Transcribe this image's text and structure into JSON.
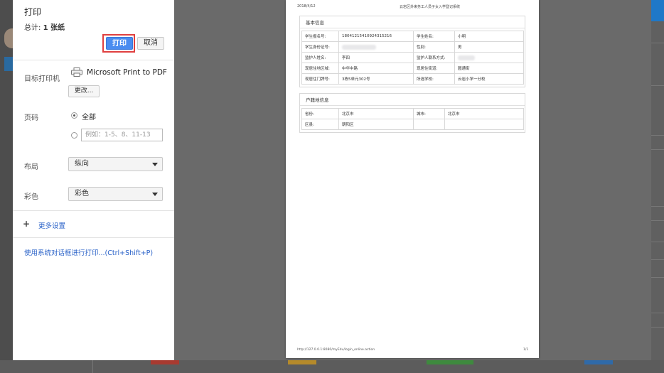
{
  "dialog": {
    "title": "打印",
    "total_label": "总计:",
    "total_value": "1 张纸",
    "print_label": "打印",
    "cancel_label": "取消",
    "destination_label": "目标打印机",
    "destination_name": "Microsoft Print to PDF",
    "change_label": "更改...",
    "pages_label": "页码",
    "pages_all": "全部",
    "pages_placeholder": "例如：1-5、8、11-13",
    "layout_label": "布局",
    "layout_value": "纵向",
    "color_label": "彩色",
    "color_value": "彩色",
    "more_settings": "更多设置",
    "system_dialog": "使用系统对话框进行打印...(Ctrl+Shift+P)"
  },
  "preview": {
    "date": "2018/4/12",
    "header_title": "云岩区外来务工人员子女入学登记系统",
    "basic_title": "基本信息",
    "basic_rows": [
      [
        "学生报名号:",
        "18041215410924315216",
        "学生姓名:",
        "小明"
      ],
      [
        "学生身份证号:",
        "",
        "性别:",
        "男"
      ],
      [
        "监护人姓名:",
        "李四",
        "监护人联系方式:",
        ""
      ],
      [
        "现居住地区域:",
        "中华中路",
        "现居住街道:",
        "圆通街"
      ],
      [
        "现居住门牌号:",
        "3栋5单元302号",
        "所选学校:",
        "云岩小学一分校"
      ]
    ],
    "household_title": "户籍地信息",
    "household_rows": [
      [
        "省份:",
        "北京市",
        "城市:",
        "北京市"
      ],
      [
        "区县:",
        "朝阳区",
        "",
        ""
      ]
    ],
    "footer_url": "http://127.0.0.1:8080/myEdu/login_online.action",
    "footer_page": "1/1"
  },
  "colors": {
    "accent": "#4a8cf0",
    "highlight": "#e04040",
    "link": "#2a62c8"
  }
}
